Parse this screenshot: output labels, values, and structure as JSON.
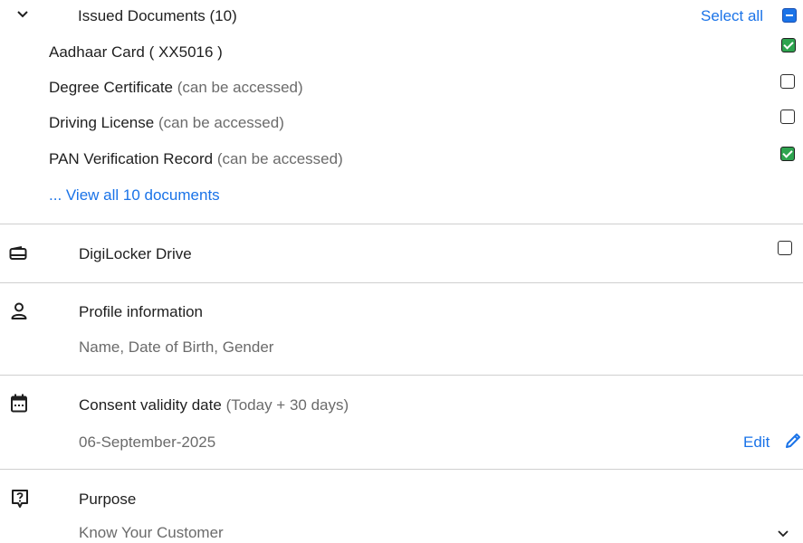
{
  "issued_documents": {
    "header": "Issued Documents (10)",
    "select_all": "Select all",
    "items": [
      {
        "name": "Aadhaar Card ( XX5016 )",
        "note": "",
        "checked": true
      },
      {
        "name": "Degree Certificate",
        "note": "(can be accessed)",
        "checked": false
      },
      {
        "name": "Driving License",
        "note": "(can be accessed)",
        "checked": false
      },
      {
        "name": "PAN Verification Record",
        "note": "(can be accessed)",
        "checked": true
      }
    ],
    "view_all": "... View all 10 documents"
  },
  "drive": {
    "label": "DigiLocker Drive",
    "checked": false
  },
  "profile": {
    "title": "Profile information",
    "subtitle": "Name, Date of Birth, Gender"
  },
  "consent": {
    "title": "Consent validity date",
    "note": "(Today + 30 days)",
    "date": "06-September-2025",
    "edit": "Edit"
  },
  "purpose": {
    "title": "Purpose",
    "value": "Know Your Customer"
  },
  "colors": {
    "accent": "#1a73e8",
    "checked": "#2ea44f",
    "divider": "#cfcfcf"
  },
  "icons": {
    "collapse": "chevron-down-icon",
    "drive": "wallet-icon",
    "profile": "person-icon",
    "consent": "calendar-icon",
    "purpose": "question-icon",
    "edit": "pencil-icon",
    "dropdown": "chevron-down-icon"
  }
}
